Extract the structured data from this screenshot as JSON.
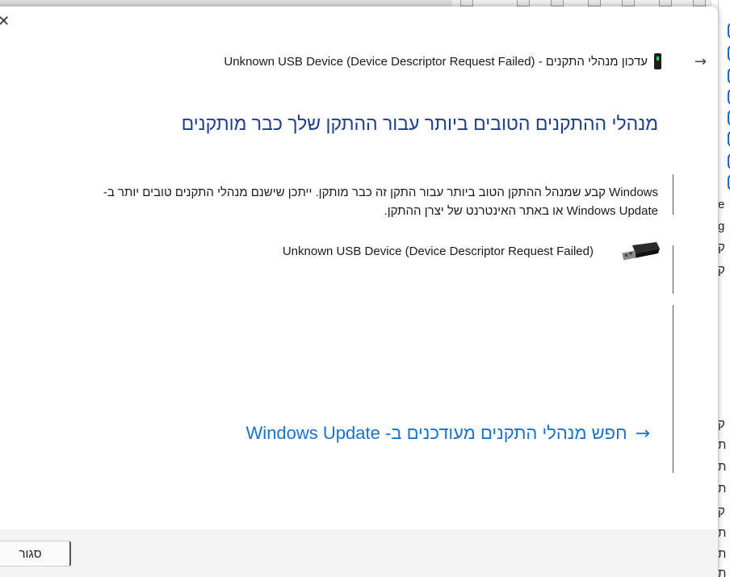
{
  "dialog": {
    "title": "עדכון מנהלי התקנים - (Unknown USB Device (Device Descriptor Request Failed",
    "heading": "מנהלי ההתקנים הטובים ביותר עבור ההתקן שלך כבר מותקנים",
    "description": "Windows קבע שמנהל ההתקן הטוב ביותר עבור התקן זה כבר מותקן. ייתכן שישנם מנהלי התקנים טובים יותר ב- Windows Update או באתר האינטרנט של יצרן ההתקן.",
    "device_name": "Unknown USB Device (Device Descriptor Request Failed)",
    "update_link_label": "חפש מנהלי התקנים מעודכנים ב- Windows Update",
    "close_button_label": "סגור"
  },
  "background_app": {
    "visible_chars": [
      "e",
      "g",
      "ק",
      "ק",
      "ק",
      "ת",
      "ת",
      "ת",
      "ק",
      "ת",
      "ת",
      "ת"
    ]
  },
  "icons": {
    "close": "close-icon",
    "back": "back-arrow-icon",
    "device": "device-manager-icon",
    "usb": "usb-plug-icon",
    "link_arrow": "arrow-right-icon"
  },
  "colors": {
    "heading": "#1e3e8c",
    "link": "#1a73c9",
    "footer_bg": "#f3f3f3",
    "background_tabs": "#0a64d6"
  }
}
